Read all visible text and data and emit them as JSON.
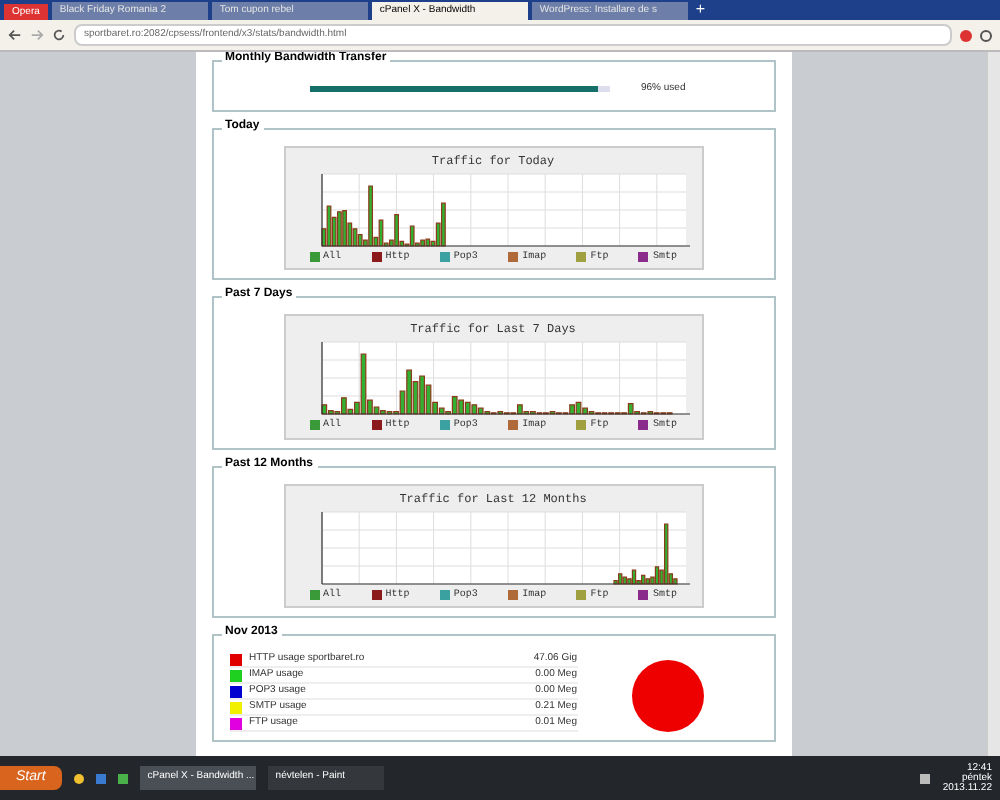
{
  "browser": {
    "menu_label": "Opera",
    "tabs": [
      {
        "title": "Black Friday Romania 2",
        "selected": false
      },
      {
        "title": "Tom cupon rebel",
        "selected": false
      },
      {
        "title": "cPanel X - Bandwidth",
        "selected": true
      },
      {
        "title": "WordPress: Installare de s",
        "selected": false
      }
    ],
    "new_tab_label": "+",
    "address": {
      "url": "sportbaret.ro:2082/cpsess/frontend/x3/stats/bandwidth.html"
    }
  },
  "page": {
    "bandwidth": {
      "title": "Monthly Bandwidth Transfer",
      "level": 0.96,
      "reading": "96% used"
    },
    "graphs": [
      {
        "title": "Today",
        "kind": "today",
        "chart_title": "Traffic for Today",
        "legend": [
          {
            "label": "All",
            "color": "#3a9a3a"
          },
          {
            "label": "Http",
            "color": "#8b1a1a"
          },
          {
            "label": "Pop3",
            "color": "#3aa0a0"
          },
          {
            "label": "Imap",
            "color": "#b06a3a"
          },
          {
            "label": "Ftp",
            "color": "#a0a040"
          },
          {
            "label": "Smtp",
            "color": "#8a2a8a"
          }
        ]
      },
      {
        "title": "Past 7 Days",
        "kind": "week",
        "chart_title": "Traffic for Last 7 Days",
        "legend": [
          {
            "label": "All",
            "color": "#3a9a3a"
          },
          {
            "label": "Http",
            "color": "#8b1a1a"
          },
          {
            "label": "Pop3",
            "color": "#3aa0a0"
          },
          {
            "label": "Imap",
            "color": "#b06a3a"
          },
          {
            "label": "Ftp",
            "color": "#a0a040"
          },
          {
            "label": "Smtp",
            "color": "#8a2a8a"
          }
        ]
      },
      {
        "title": "Past 12 Months",
        "kind": "year",
        "chart_title": "Traffic for Last 12 Months",
        "legend": [
          {
            "label": "All",
            "color": "#3a9a3a"
          },
          {
            "label": "Http",
            "color": "#8b1a1a"
          },
          {
            "label": "Pop3",
            "color": "#3aa0a0"
          },
          {
            "label": "Imap",
            "color": "#b06a3a"
          },
          {
            "label": "Ftp",
            "color": "#a0a040"
          },
          {
            "label": "Smtp",
            "color": "#8a2a8a"
          }
        ]
      }
    ],
    "month": {
      "title": "Nov 2013",
      "rows": [
        {
          "label": "HTTP usage sportbaret.ro",
          "value": "47.06 Gig",
          "color": "#e00000"
        },
        {
          "label": "IMAP usage",
          "value": "0.00 Meg",
          "color": "#20d020"
        },
        {
          "label": "POP3 usage",
          "value": "0.00 Meg",
          "color": "#0000d0"
        },
        {
          "label": "SMTP usage",
          "value": "0.21 Meg",
          "color": "#f0f000"
        },
        {
          "label": "FTP usage",
          "value": "0.01 Meg",
          "color": "#e000e0"
        }
      ]
    }
  },
  "taskbar": {
    "start": "Start",
    "tasks": [
      {
        "label": "cPanel X - Bandwidth ...",
        "selected": true
      },
      {
        "label": "névtelen - Paint",
        "selected": false
      }
    ],
    "clock": {
      "time": "12:41",
      "day": "péntek",
      "date": "2013.11.22"
    }
  }
}
